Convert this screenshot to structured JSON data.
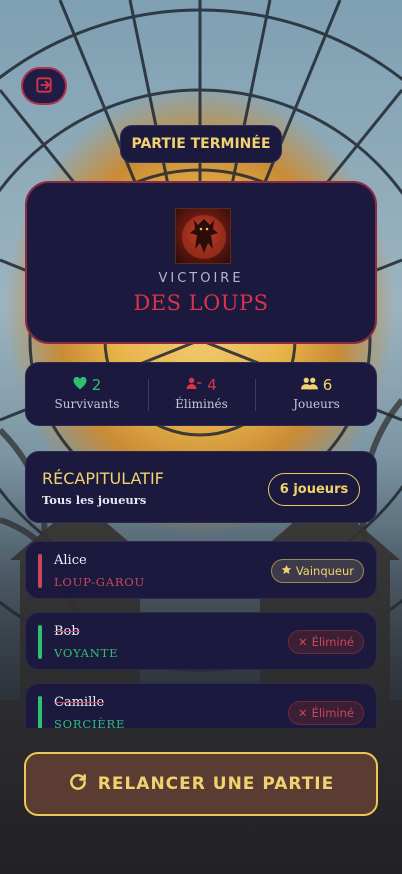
{
  "header": {
    "exit_icon": "logout-icon",
    "status_title": "PARTIE TERMINÉE"
  },
  "victory": {
    "label": "VICTOIRE",
    "team": "DES LOUPS",
    "portrait_icon": "werewolf-portrait"
  },
  "stats": [
    {
      "icon": "heart-icon",
      "value": "2",
      "label": "Survivants",
      "color": "#2fbf71"
    },
    {
      "icon": "user-minus-icon",
      "value": "4",
      "label": "Éliminés",
      "color": "#d9344a"
    },
    {
      "icon": "users-icon",
      "value": "6",
      "label": "Joueurs",
      "color": "#f2d26e"
    }
  ],
  "recap": {
    "title": "RÉCAPITULATIF",
    "subtitle": "Tous les joueurs",
    "count": "6 joueurs"
  },
  "players": [
    {
      "name": "Alice",
      "role": "LOUP-GAROU",
      "role_color": "#c9475a",
      "bar_color": "#c9475a",
      "badge": "Vainqueur",
      "badge_icon": "star-icon",
      "status": "winner"
    },
    {
      "name": "Bob",
      "role": "VOYANTE",
      "role_color": "#2fbf71",
      "bar_color": "#2fbf71",
      "badge": "Éliminé",
      "badge_icon": "close-icon",
      "status": "eliminated"
    },
    {
      "name": "Camille",
      "role": "SORCIÈRE",
      "role_color": "#2fbf71",
      "bar_color": "#2fbf71",
      "badge": "Éliminé",
      "badge_icon": "close-icon",
      "status": "eliminated"
    }
  ],
  "action": {
    "label": "RELANCER UNE PARTIE",
    "icon": "refresh-icon"
  },
  "colors": {
    "accent": "#f2d26e",
    "danger": "#d9344a",
    "success": "#2fbf71",
    "card": "#1b1a3e"
  }
}
